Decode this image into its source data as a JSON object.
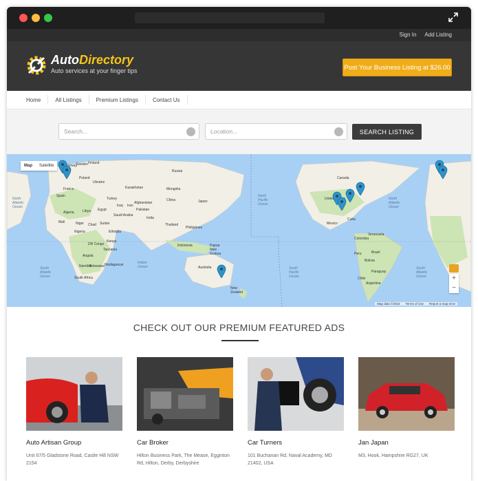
{
  "topbar": {
    "sign_in": "Sign In",
    "add_listing": "Add Listing"
  },
  "header": {
    "logo_part1": "Auto",
    "logo_part2": "Directory",
    "tagline": "Auto services at your finger tips",
    "cta_label": "Post Your Business Listing at $26.00"
  },
  "nav": {
    "items": [
      "Home",
      "All Listings",
      "Premium Listings",
      "Contact Us"
    ]
  },
  "search": {
    "search_placeholder": "Search...",
    "location_placeholder": "Location...",
    "button_label": "SEARCH LISTING"
  },
  "map": {
    "toggle": [
      "Map",
      "Satellite"
    ],
    "zoom_in": "+",
    "zoom_out": "−",
    "footer": [
      "Map data ©2016",
      "Terms of Use",
      "Report a map error"
    ],
    "labels": {
      "north_atlantic_w": "North Atlantic Ocean",
      "north_pacific": "North Pacific Ocean",
      "north_atlantic_e": "North Atlantic Ocean",
      "indian_ocean": "Indian Ocean",
      "south_atlantic_w": "South Atlantic Ocean",
      "south_pacific": "South Pacific Ocean",
      "south_atlantic_e": "South Atlantic Ocean",
      "australia": "Australia",
      "new_zealand": "New Zealand",
      "russia": "Russia",
      "china": "China",
      "india": "India",
      "indonesia": "Indonesia",
      "brazil": "Brazil",
      "mexico": "Mexico",
      "united_states": "United States",
      "canada": "Canada",
      "south_africa": "South Africa",
      "kazakhstan": "Kazakhstan",
      "mongolia": "Mongolia",
      "egypt": "Egypt",
      "libya": "Libya",
      "algeria": "Algeria",
      "niger": "Niger",
      "sudan": "Sudan",
      "chad": "Chad",
      "mali": "Mali",
      "nigeria": "Nigeria",
      "ethiopia": "Ethiopia",
      "kenya": "Kenya",
      "tanzania": "Tanzania",
      "dr_congo": "DR Congo",
      "angola": "Angola",
      "namibia": "Namibia",
      "botswana": "Botswana",
      "madagascar": "Madagascar",
      "saudi_arabia": "Saudi Arabia",
      "iran": "Iran",
      "iraq": "Iraq",
      "turkey": "Turkey",
      "pakistan": "Pakistan",
      "afghanistan": "Afghanistan",
      "thailand": "Thailand",
      "japan": "Japan",
      "philippines": "Philippines",
      "papua_new_guinea": "Papua New Guinea",
      "peru": "Peru",
      "bolivia": "Bolivia",
      "colombia": "Colombia",
      "venezuela": "Venezuela",
      "argentina": "Argentina",
      "chile": "Chile",
      "france": "France",
      "spain": "Spain",
      "poland": "Poland",
      "ukraine": "Ukraine",
      "sweden": "Sweden",
      "norway": "Norway",
      "finland": "Finland",
      "paraguay": "Paraguay",
      "cuba": "Cuba"
    },
    "colors": {
      "water": "#a8d0f5",
      "land": "#f2efe6",
      "green": "#cde4b4",
      "marker": "#2f93c8"
    }
  },
  "featured": {
    "title": "CHECK OUT OUR PREMIUM FEATURED ADS",
    "cards": [
      {
        "name": "Auto Artisan Group",
        "address": "Unit 67/5 Gladstone Road, Castle Hill NSW 2154"
      },
      {
        "name": "Car Broker",
        "address": "Hilton Business Park, The Mease, Egginton Rd, Hilton, Derby, Derbyshire"
      },
      {
        "name": "Car Turners",
        "address": "101 Buchanan Rd, Naval Academy, MD 21402, USA"
      },
      {
        "name": "Jan Japan",
        "address": "M3, Hook, Hampshire RG27, UK"
      }
    ]
  },
  "colors": {
    "accent": "#f0ad1a",
    "header_bg": "#363636",
    "logo_yellow": "#f5c518"
  }
}
